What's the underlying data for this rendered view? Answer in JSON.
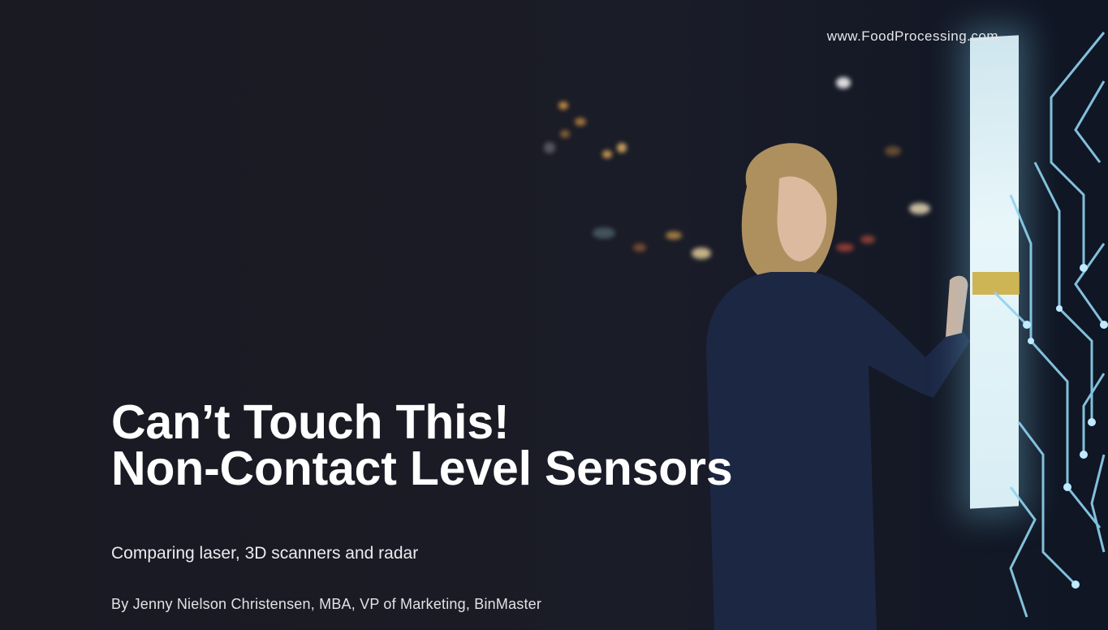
{
  "site": {
    "url": "www.FoodProcessing.com"
  },
  "headline": {
    "line1": "Can’t Touch This!",
    "line2": "Non-Contact Level Sensors"
  },
  "subtitle": "Comparing laser, 3D scanners and radar",
  "byline": "By Jenny Nielson Christensen, MBA, VP of Marketing, BinMaster",
  "colors": {
    "background": "#1a1a23",
    "text": "#ffffff",
    "screen_glow": "#9fd6ea",
    "circuit": "#8fd3f0"
  },
  "background_image": {
    "icon": "woman-touching-digital-screen-photo"
  }
}
